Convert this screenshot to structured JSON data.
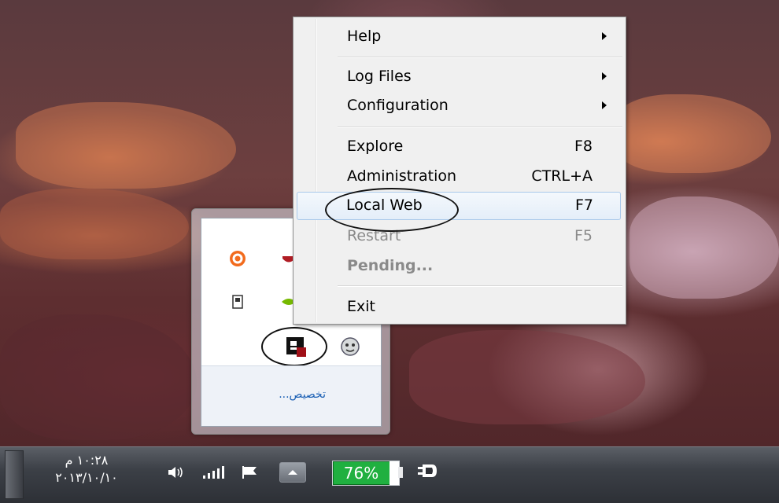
{
  "menu": {
    "items": [
      {
        "label": "Help",
        "shortcut": "",
        "submenu": true
      },
      {
        "label": "Log Files",
        "shortcut": "",
        "submenu": true
      },
      {
        "label": "Configuration",
        "shortcut": "",
        "submenu": true
      },
      {
        "label": "Explore",
        "shortcut": "F8"
      },
      {
        "label": "Administration",
        "shortcut": "CTRL+A"
      },
      {
        "label": "Local Web",
        "shortcut": "F7",
        "highlighted": true
      },
      {
        "label": "Restart",
        "shortcut": "F5",
        "disabled": true
      },
      {
        "label": "Pending...",
        "shortcut": "",
        "disabled": true
      },
      {
        "label": "Exit",
        "shortcut": ""
      }
    ]
  },
  "tray_flyout": {
    "customize_label": "تخصيص...",
    "icons": [
      "avast-icon",
      "shield-icon",
      "usb-icon",
      "nvidia-icon",
      "app-server-icon",
      "android-icon"
    ]
  },
  "taskbar": {
    "clock_time": "۱۰:۲۸ م",
    "clock_date": "۲۰۱۳/۱۰/۱۰",
    "battery_percent": "76%",
    "battery_level": 0.76,
    "icons": [
      "speaker-icon",
      "signal-icon",
      "flag-icon",
      "tray-expand-icon",
      "power-plug-icon"
    ]
  },
  "colors": {
    "battery": "#20b040",
    "highlight_border": "#a8c8ea",
    "link": "#1a5fb4"
  }
}
